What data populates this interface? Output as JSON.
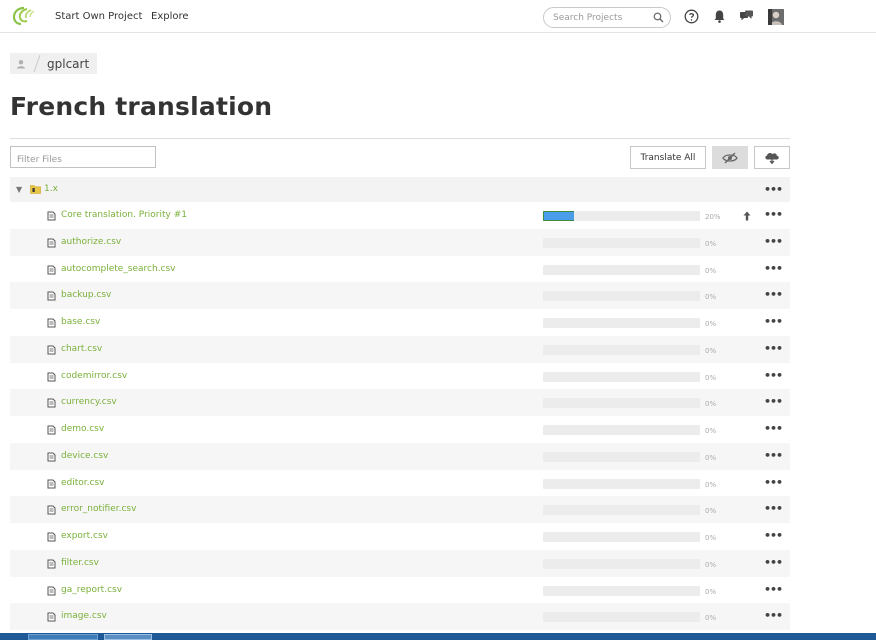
{
  "colors": {
    "accent": "#7ab03a",
    "progress": "#4a9de8",
    "brand": "#8bc34a"
  },
  "nav": {
    "logo_icon": "crowdin-logo-icon",
    "links": [
      {
        "label": "Start Own Project"
      },
      {
        "label": "Explore"
      }
    ],
    "search_placeholder": "Search Projects",
    "icons": [
      "help-icon",
      "bell-icon",
      "chat-icon"
    ]
  },
  "breadcrumb": {
    "project": "gplcart"
  },
  "page": {
    "title": "French translation"
  },
  "toolbar": {
    "filter_placeholder": "Filter Files",
    "translate_all_label": "Translate All",
    "hide_icon": "eye-slash-icon",
    "cloud_icon": "cloud-download-icon"
  },
  "tree": {
    "folder": {
      "name": "1.x",
      "more": "•••"
    },
    "files": [
      {
        "name": "Core translation. Priority #1",
        "progress": 20,
        "pct": "20%",
        "upload": true
      },
      {
        "name": "authorize.csv",
        "progress": 0,
        "pct": "0%"
      },
      {
        "name": "autocomplete_search.csv",
        "progress": 0,
        "pct": "0%"
      },
      {
        "name": "backup.csv",
        "progress": 0,
        "pct": "0%"
      },
      {
        "name": "base.csv",
        "progress": 0,
        "pct": "0%"
      },
      {
        "name": "chart.csv",
        "progress": 0,
        "pct": "0%"
      },
      {
        "name": "codemirror.csv",
        "progress": 0,
        "pct": "0%"
      },
      {
        "name": "currency.csv",
        "progress": 0,
        "pct": "0%"
      },
      {
        "name": "demo.csv",
        "progress": 0,
        "pct": "0%"
      },
      {
        "name": "device.csv",
        "progress": 0,
        "pct": "0%"
      },
      {
        "name": "editor.csv",
        "progress": 0,
        "pct": "0%"
      },
      {
        "name": "error_notifier.csv",
        "progress": 0,
        "pct": "0%"
      },
      {
        "name": "export.csv",
        "progress": 0,
        "pct": "0%"
      },
      {
        "name": "filter.csv",
        "progress": 0,
        "pct": "0%"
      },
      {
        "name": "ga_report.csv",
        "progress": 0,
        "pct": "0%"
      },
      {
        "name": "image.csv",
        "progress": 0,
        "pct": "0%"
      }
    ],
    "more_label": "•••"
  }
}
